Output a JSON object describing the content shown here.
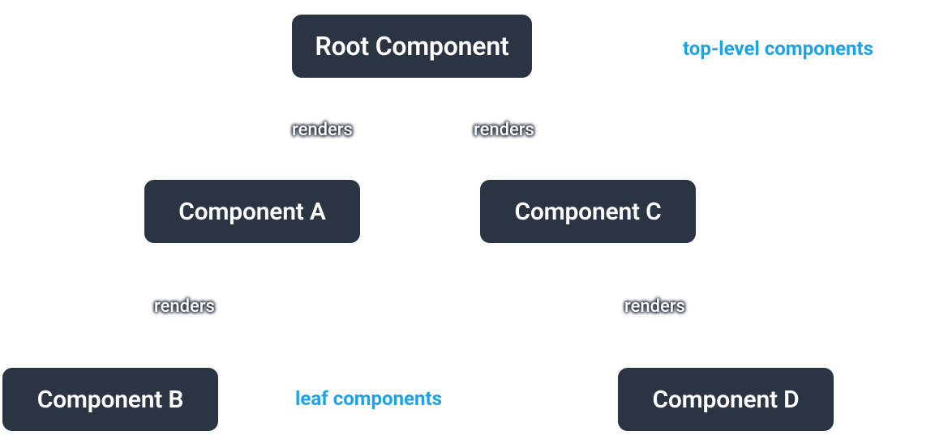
{
  "colors": {
    "node_bg": "#2b3442",
    "node_border": "#ffffff",
    "node_text": "#ffffff",
    "connector": "#ffffff",
    "annotation": "#1ba3e8",
    "edge_label": "#ffffff"
  },
  "nodes": {
    "root": "Root Component",
    "a": "Component A",
    "b": "Component B",
    "c": "Component C",
    "d": "Component D"
  },
  "edges": {
    "root_a": "renders",
    "root_c": "renders",
    "a_b": "renders",
    "c_d": "renders"
  },
  "annotations": {
    "top": "top-level components",
    "leaf": "leaf components"
  }
}
